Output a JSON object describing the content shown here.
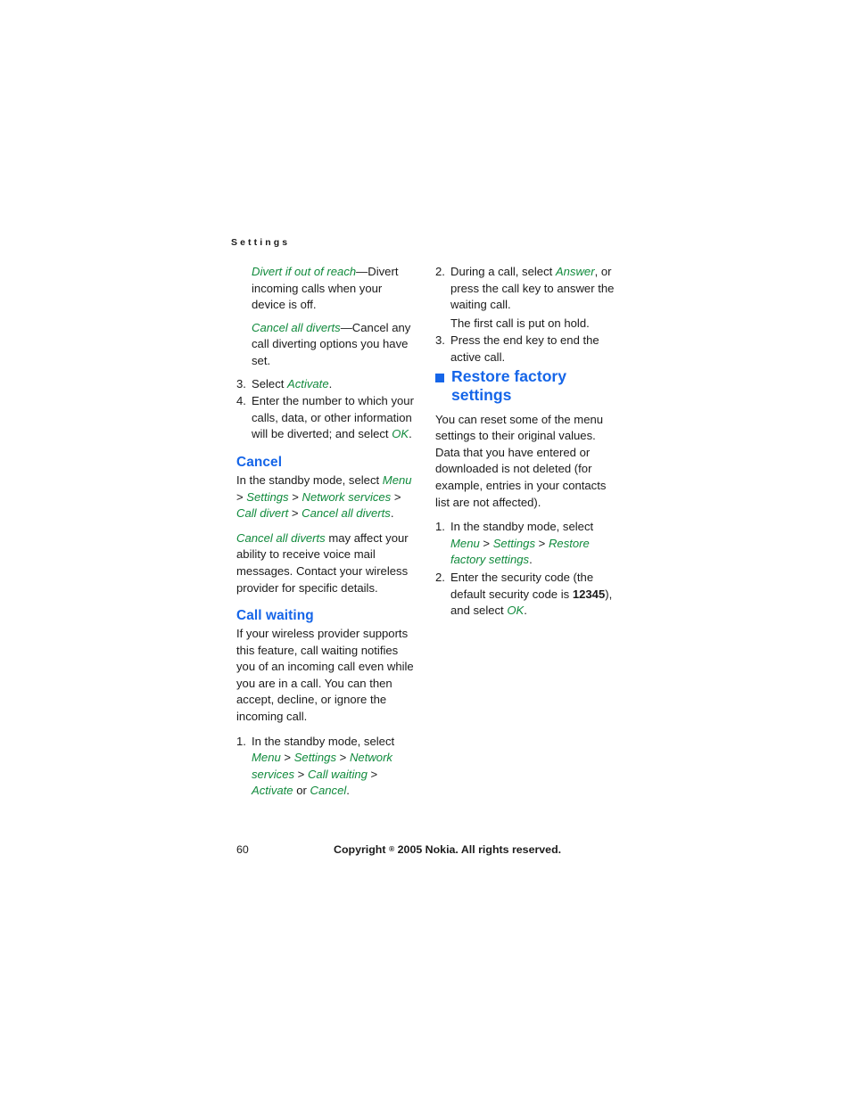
{
  "page": {
    "running_header": "Settings",
    "folio": "60",
    "copyright_pre": "Copyright ",
    "copyright_symbol": "®",
    "copyright_post": " 2005 Nokia. All rights reserved."
  },
  "colors": {
    "heading_blue": "#1565e8",
    "menu_green": "#108a3c",
    "body_text": "#1b1b1b",
    "page_background": "#ffffff"
  },
  "left_column": {
    "definitions": [
      {
        "term": "Divert if out of reach",
        "dash": "—",
        "description": "Divert incoming calls when your device is off."
      },
      {
        "term": "Cancel all diverts",
        "dash": "—",
        "description": "Cancel any call diverting options you have set."
      }
    ],
    "steps": [
      {
        "num": "3.",
        "pre": "Select ",
        "menu": "Activate",
        "post": "."
      },
      {
        "num": "4.",
        "pre": "Enter the number to which your calls, data, or other information will be diverted; and select ",
        "menu": "OK",
        "post": "."
      }
    ],
    "cancel_section": {
      "heading": "Cancel",
      "path_intro": "In the standby mode, select ",
      "path": [
        "Menu",
        "Settings",
        "Network services",
        "Call divert",
        "Cancel all diverts"
      ],
      "path_separator": " > ",
      "path_end": ".",
      "note_menu": "Cancel all diverts",
      "note_text": " may affect your ability to receive voice mail messages. Contact your wireless provider for specific details."
    },
    "call_waiting_section": {
      "heading": "Call waiting",
      "body": "If your wireless provider supports this feature, call waiting notifies you of an incoming call even while you are in a call. You can then accept, decline, or ignore the incoming call.",
      "steps": [
        {
          "num": "1.",
          "pre": "In the standby mode, select ",
          "path": [
            "Menu",
            "Settings",
            "Network services",
            "Call waiting",
            "Activate"
          ],
          "separator": " > ",
          "or_word": " or ",
          "last_menu": "Cancel",
          "post": "."
        }
      ]
    }
  },
  "right_column": {
    "continued_steps": [
      {
        "num": "2.",
        "pre": "During a call, select ",
        "menu": "Answer",
        "post": ", or press the call key to answer the waiting call.",
        "sub": "The first call is put on hold."
      },
      {
        "num": "3.",
        "pre": "Press the end key to end the active call.",
        "menu": "",
        "post": ""
      }
    ],
    "restore_section": {
      "heading_line1": "Restore factory",
      "heading_line2": "settings",
      "body": "You can reset some of the menu settings to their original values. Data that you have entered or downloaded is not deleted (for example, entries in your contacts list are not affected).",
      "steps": [
        {
          "num": "1.",
          "pre": "In the standby mode, select ",
          "path": [
            "Menu",
            "Settings",
            "Restore factory settings"
          ],
          "separator": " > ",
          "post": "."
        },
        {
          "num": "2.",
          "pre": "Enter the security code (the default security code is ",
          "code": "12345",
          "mid": "), and select ",
          "menu": "OK",
          "post": "."
        }
      ]
    }
  }
}
